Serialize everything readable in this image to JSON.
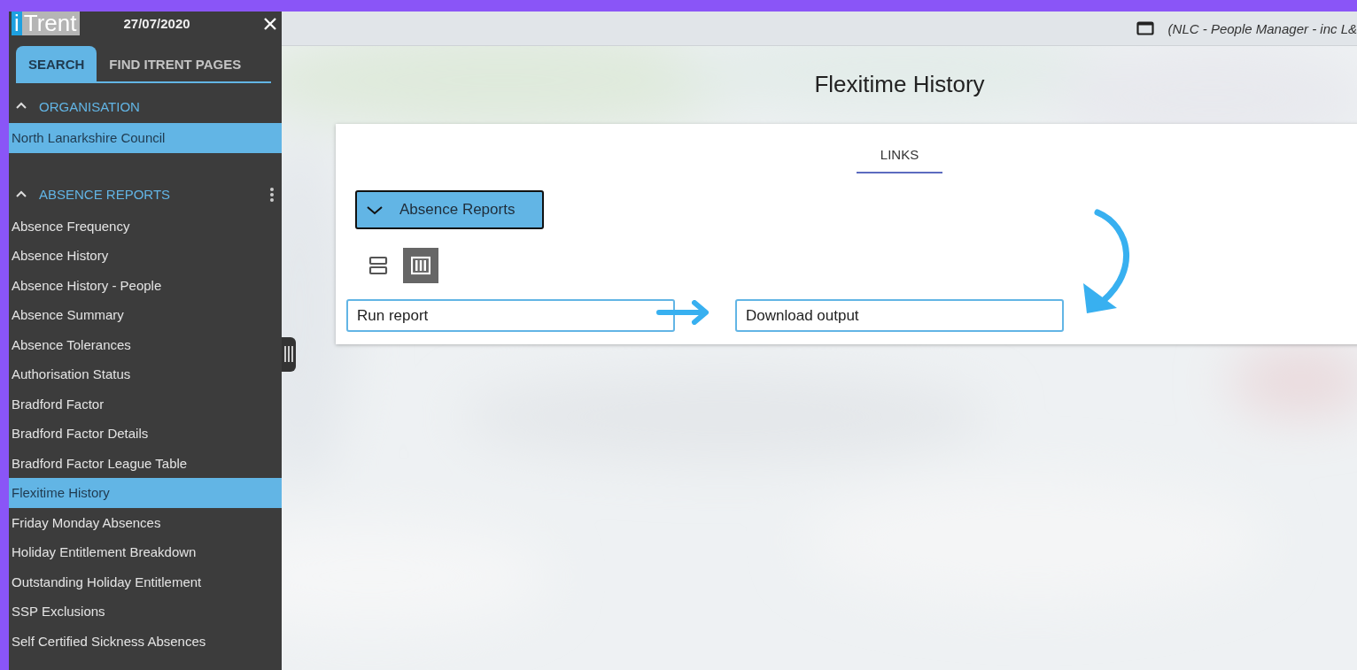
{
  "sidebar": {
    "logo": {
      "letter": "i",
      "word": "Trent"
    },
    "date": "27/07/2020",
    "tabs": [
      {
        "label": "SEARCH",
        "selected": true
      },
      {
        "label": "FIND ITRENT PAGES",
        "selected": false
      }
    ],
    "sections": [
      {
        "title": "ORGANISATION",
        "expanded": true,
        "menu": false,
        "items": [
          {
            "label": "North Lanarkshire Council",
            "selected": true
          }
        ]
      },
      {
        "title": "ABSENCE REPORTS",
        "expanded": true,
        "menu": true,
        "items": [
          {
            "label": "Absence Frequency",
            "selected": false
          },
          {
            "label": "Absence History",
            "selected": false
          },
          {
            "label": "Absence History - People",
            "selected": false
          },
          {
            "label": "Absence Summary",
            "selected": false
          },
          {
            "label": "Absence Tolerances",
            "selected": false
          },
          {
            "label": "Authorisation Status",
            "selected": false
          },
          {
            "label": "Bradford Factor",
            "selected": false
          },
          {
            "label": "Bradford Factor Details",
            "selected": false
          },
          {
            "label": "Bradford Factor League Table",
            "selected": false
          },
          {
            "label": "Flexitime History",
            "selected": true
          },
          {
            "label": "Friday Monday Absences",
            "selected": false
          },
          {
            "label": "Holiday Entitlement Breakdown",
            "selected": false
          },
          {
            "label": "Outstanding Holiday Entitlement",
            "selected": false
          },
          {
            "label": "SSP Exclusions",
            "selected": false
          },
          {
            "label": "Self Certified Sickness Absences",
            "selected": false
          }
        ]
      }
    ]
  },
  "top_bar": {
    "context": "(NLC - People Manager - inc L&"
  },
  "page": {
    "title": "Flexitime History",
    "tabs": [
      {
        "label": "LINKS",
        "selected": true
      }
    ],
    "group": {
      "label": "Absence Reports",
      "expanded": true
    },
    "view_toggles": [
      {
        "kind": "rows",
        "selected": false
      },
      {
        "kind": "columns",
        "selected": true
      }
    ],
    "links": [
      {
        "label": "Run report"
      },
      {
        "label": "Download output"
      }
    ]
  }
}
